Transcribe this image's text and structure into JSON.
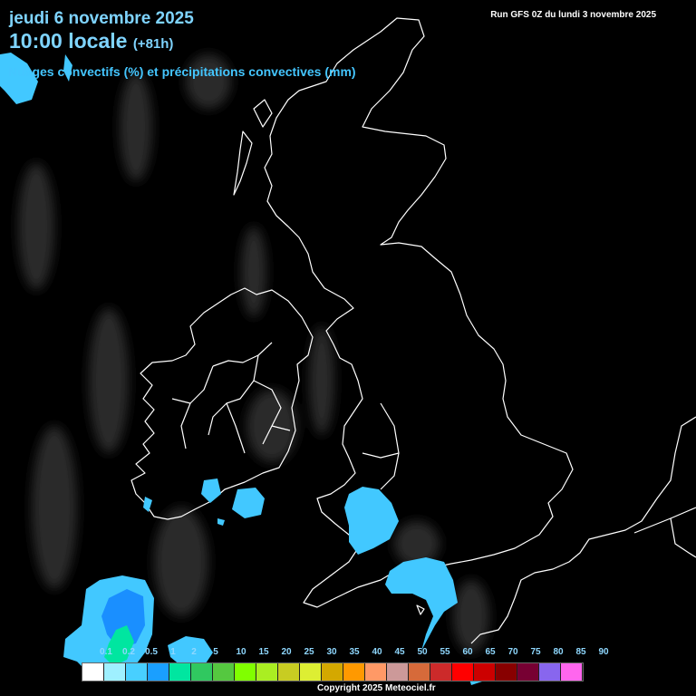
{
  "header": {
    "date": "jeudi 6 novembre 2025",
    "time": "10:00 locale",
    "lead": "(+81h)",
    "run": "Run GFS 0Z du lundi 3 novembre 2025",
    "subtitle": "Nuages convectifs (%) et précipitations convectives (mm)"
  },
  "legend": {
    "labels": [
      "0.1",
      "0.2",
      "0.5",
      "1",
      "2",
      "5",
      "10",
      "15",
      "20",
      "25",
      "30",
      "35",
      "40",
      "45",
      "50",
      "55",
      "60",
      "65",
      "70",
      "75",
      "80",
      "85",
      "90"
    ],
    "colors": [
      "#ffffff",
      "#9ff0ff",
      "#48cfff",
      "#1a9fff",
      "#00e6a0",
      "#30c860",
      "#55c840",
      "#80ff00",
      "#aaee22",
      "#c8cc22",
      "#ddee33",
      "#d4a800",
      "#ff9900",
      "#ff9966",
      "#cc9999",
      "#d66a3a",
      "#cc2a2a",
      "#ff0000",
      "#cc0000",
      "#880000",
      "#770033",
      "#8866ee",
      "#ff66ee"
    ]
  },
  "footer": {
    "copyright": "Copyright 2025 Meteociel.fr"
  },
  "colors": {
    "title": "#7fd4ff",
    "subtitle": "#44c6ff",
    "coast": "#ffffff",
    "precip": "#42c8ff"
  }
}
